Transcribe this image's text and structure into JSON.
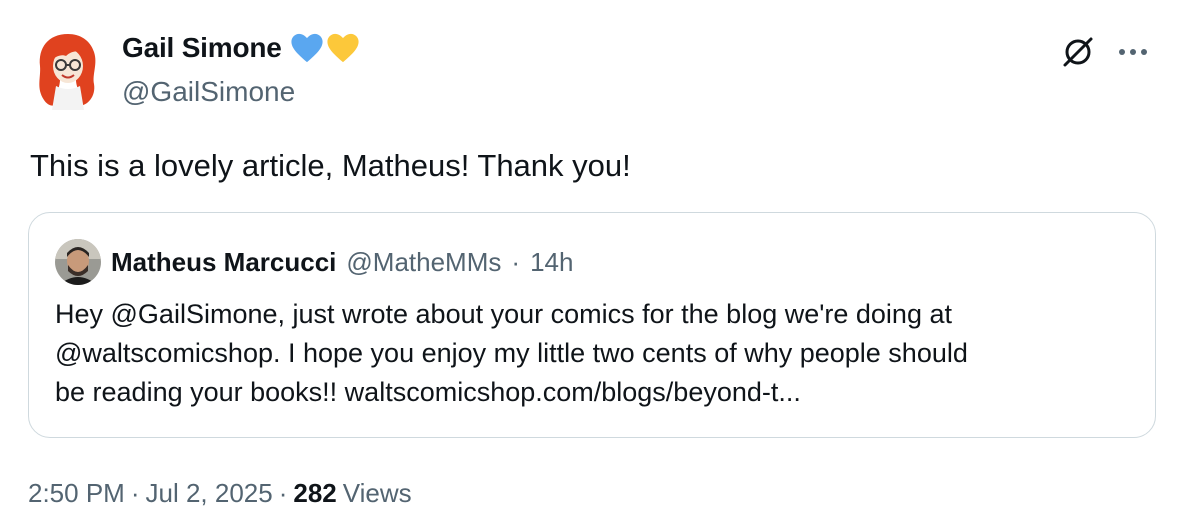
{
  "author": {
    "name": "Gail Simone",
    "handle": "@GailSimone",
    "avatar_icon": "red-haired-woman-cartoon-avatar",
    "badges": [
      {
        "icon": "blue-heart-icon",
        "color": "#5aa7f0"
      },
      {
        "icon": "yellow-heart-icon",
        "color": "#fcc83a"
      }
    ]
  },
  "toolbar": {
    "grok_icon": "grok-icon",
    "more_icon": "more-horizontal-icon"
  },
  "tweet": {
    "text": "This is a lovely article, Matheus! Thank you!"
  },
  "quote": {
    "name": "Matheus Marcucci",
    "handle": "@MatheMMs",
    "separator": "·",
    "time": "14h",
    "lines": [
      "Hey @GailSimone, just wrote about your comics for the blog we're doing at",
      "@waltscomicshop. I hope you enjoy my little two cents of why people should",
      "be reading your books!! waltscomicshop.com/blogs/beyond-t..."
    ]
  },
  "footer": {
    "time": "2:50 PM",
    "sep1": "·",
    "date": "Jul 2, 2025",
    "sep2": "·",
    "views_count": "282",
    "views_label": "Views"
  }
}
